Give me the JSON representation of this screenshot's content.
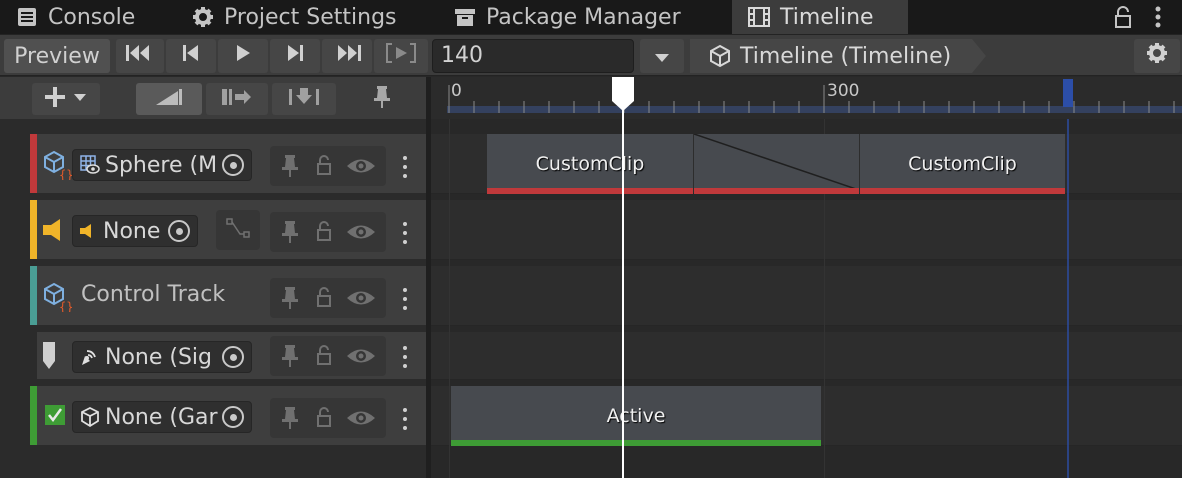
{
  "tabs": [
    {
      "label": "Console",
      "icon": "console-icon"
    },
    {
      "label": "Project Settings",
      "icon": "gear-icon"
    },
    {
      "label": "Package Manager",
      "icon": "package-icon"
    },
    {
      "label": "Timeline",
      "icon": "film-icon",
      "active": true
    }
  ],
  "toolbar": {
    "preview_label": "Preview",
    "frame_value": "140",
    "breadcrumb": "Timeline (Timeline)"
  },
  "ruler": {
    "ticks": [
      "0",
      "300"
    ],
    "playhead_frame": 140
  },
  "tracks": [
    {
      "name": "Sphere (M",
      "kind": "custom",
      "color": "#c0393b"
    },
    {
      "name": "None",
      "kind": "audio",
      "color": "#f0b429"
    },
    {
      "name": "Control Track",
      "kind": "control",
      "color": "#4a9e95"
    },
    {
      "name": "None (Sig",
      "kind": "signal",
      "color": "#d0d0d0"
    },
    {
      "name": "None (Gar",
      "kind": "activation",
      "color": "#3e9c35"
    }
  ],
  "clips": [
    {
      "label": "CustomClip",
      "track": 0,
      "bar_color": "#c0393b"
    },
    {
      "label": "CustomClip",
      "track": 0,
      "bar_color": "#c0393b"
    },
    {
      "label": "Active",
      "track": 4,
      "bar_color": "#3e9c35"
    }
  ]
}
